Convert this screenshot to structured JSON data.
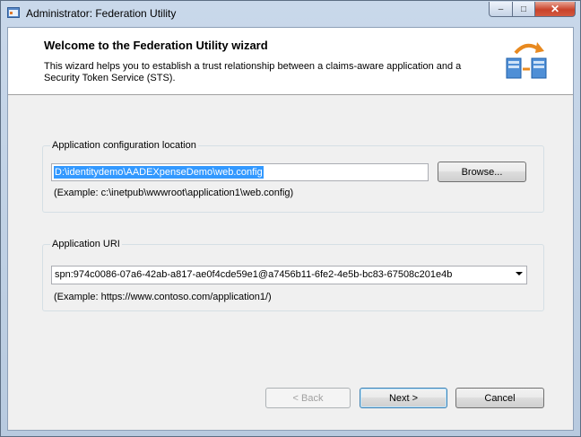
{
  "window": {
    "title": "Administrator: Federation Utility",
    "minimize_glyph": "–",
    "maximize_glyph": "□",
    "close_glyph": "✕"
  },
  "header": {
    "title": "Welcome to the Federation Utility wizard",
    "description": "This wizard helps you to establish a trust relationship between a claims-aware application and a Security Token Service (STS).",
    "art_icon": "federation-servers-icon"
  },
  "config_location": {
    "group_label": "Application configuration location",
    "value": "D:\\identitydemo\\AADEXpenseDemo\\web.config",
    "browse_label": "Browse...",
    "example": "(Example: c:\\inetpub\\wwwroot\\application1\\web.config)"
  },
  "app_uri": {
    "group_label": "Application URI",
    "value": "spn:974c0086-07a6-42ab-a817-ae0f4cde59e1@a7456b11-6fe2-4e5b-bc83-67508c201e4b",
    "example": "(Example: https://www.contoso.com/application1/)"
  },
  "footer": {
    "back_label": "< Back",
    "next_label": "Next >",
    "cancel_label": "Cancel"
  },
  "colors": {
    "selection": "#3399ff",
    "close_button": "#c9432b",
    "frame": "#c9d8ea"
  }
}
